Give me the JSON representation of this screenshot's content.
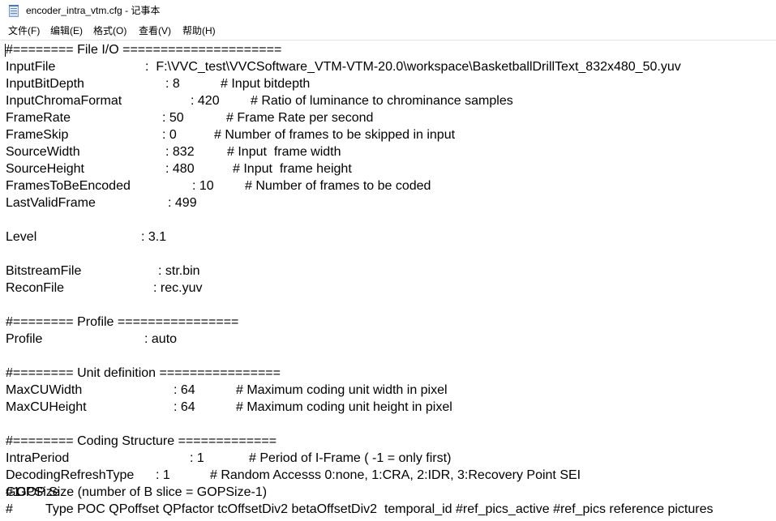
{
  "window": {
    "title": "encoder_intra_vtm.cfg - 记事本",
    "icon": "notepad-icon"
  },
  "menu": [
    {
      "label": "文件(F)"
    },
    {
      "label": "编辑(E)"
    },
    {
      "label": "格式(O)"
    },
    {
      "label": "查看(V)"
    },
    {
      "label": "帮助(H)"
    }
  ],
  "lines": [
    {
      "key": "#======== File I/O =====================",
      "value": "",
      "comment": ""
    },
    {
      "key": "InputFile",
      "value": ":  F:\\VVC_test\\VVCSoftware_VTM-VTM-20.0\\workspace\\BasketballDrillText_832x480_50.yuv",
      "comment": ""
    },
    {
      "key": "InputBitDepth",
      "value": ": 8",
      "comment": "# Input bitdepth"
    },
    {
      "key": "InputChromaFormat",
      "value": ": 420",
      "comment": "# Ratio of luminance to chrominance samples"
    },
    {
      "key": "FrameRate",
      "value": ": 50",
      "comment": "# Frame Rate per second"
    },
    {
      "key": "FrameSkip",
      "value": ": 0",
      "comment": "# Number of frames to be skipped in input"
    },
    {
      "key": "SourceWidth",
      "value": ": 832",
      "comment": "# Input  frame width"
    },
    {
      "key": "SourceHeight",
      "value": ": 480",
      "comment": "# Input  frame height"
    },
    {
      "key": "FramesToBeEncoded",
      "value": ": 10",
      "comment": "# Number of frames to be coded"
    },
    {
      "key": "LastValidFrame",
      "value": ": 499",
      "comment": ""
    },
    {
      "key": "",
      "value": "",
      "comment": ""
    },
    {
      "key": "Level",
      "value": ": 3.1",
      "comment": ""
    },
    {
      "key": "",
      "value": "",
      "comment": ""
    },
    {
      "key": "BitstreamFile",
      "value": ": str.bin",
      "comment": ""
    },
    {
      "key": "ReconFile",
      "value": ": rec.yuv",
      "comment": ""
    },
    {
      "key": "",
      "value": "",
      "comment": ""
    },
    {
      "key": "#======== Profile ================",
      "value": "",
      "comment": ""
    },
    {
      "key": "Profile",
      "value": ": auto",
      "comment": ""
    },
    {
      "key": "",
      "value": "",
      "comment": ""
    },
    {
      "key": "#======== Unit definition ================",
      "value": "",
      "comment": ""
    },
    {
      "key": "MaxCUWidth",
      "value": ": 64",
      "comment": "# Maximum coding unit width in pixel"
    },
    {
      "key": "MaxCUHeight",
      "value": ": 64",
      "comment": "# Maximum coding unit height in pixel"
    },
    {
      "key": "",
      "value": "",
      "comment": ""
    },
    {
      "key": "#======== Coding Structure =============",
      "value": "",
      "comment": ""
    },
    {
      "key": "IntraPeriod",
      "value": ": 1",
      "comment": "# Period of I-Frame ( -1 = only first)"
    },
    {
      "key": "DecodingRefreshType",
      "value": ": 1",
      "comment": "# Random Accesss 0:none, 1:CRA, 2:IDR, 3:Recovery Point SEI"
    },
    {
      "key": "GOPSize",
      "value": ": 1",
      "comment": "# GOP Size (number of B slice = GOPSize-1)"
    },
    {
      "key": "#",
      "value": "",
      "comment": "Type POC QPoffset QPfactor tcOffsetDiv2 betaOffsetDiv2  temporal_id #ref_pics_active #ref_pics reference pictures"
    }
  ]
}
